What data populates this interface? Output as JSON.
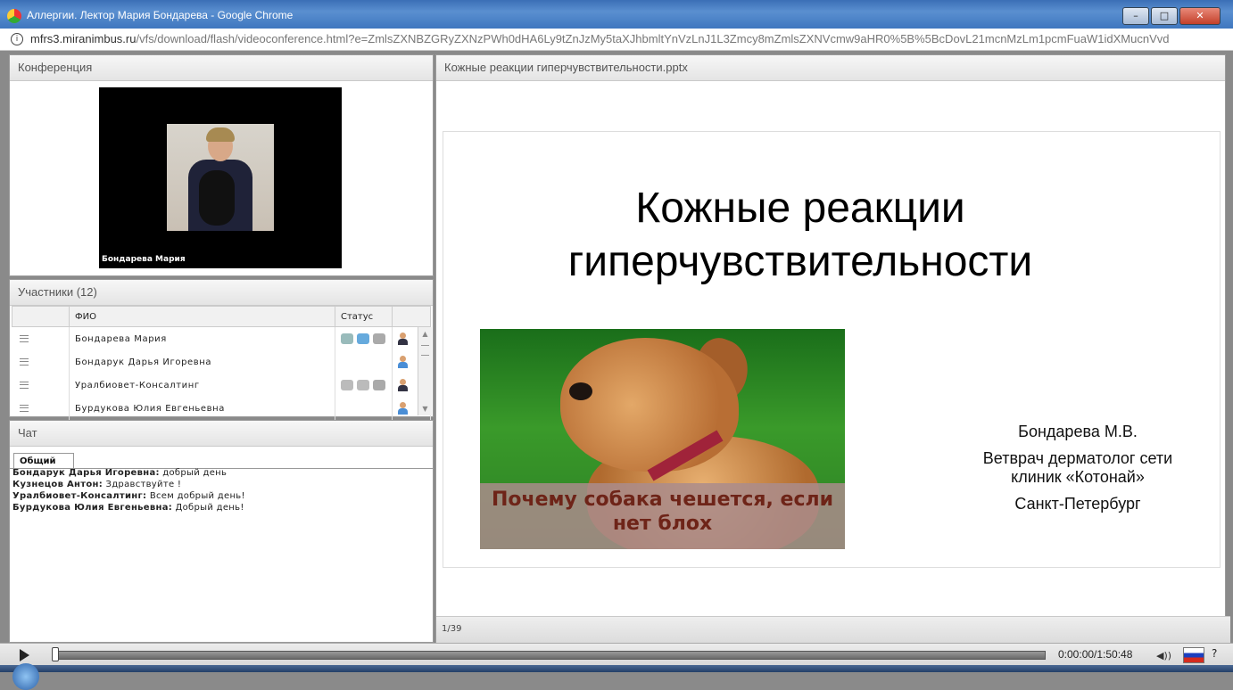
{
  "window": {
    "title": "Аллергии. Лектор Мария Бондарева - Google Chrome",
    "minimize": "–",
    "maximize": "□",
    "close": "✕"
  },
  "address": {
    "host": "mfrs3.miranimbus.ru",
    "path": "/vfs/download/flash/videoconference.html?e=ZmlsZXNBZGRyZXNzPWh0dHA6Ly9tZnJzMy5taXJhbmltYnVzLnJ1L3Zmcy8mZmlsZXNVcmw9aHR0%5B%5BcDovL21mcnMzLm1pcmFuaW1idXMucnVvd"
  },
  "conference": {
    "header": "Конференция",
    "video_name": "Бондарева Мария"
  },
  "participants": {
    "header": "Участники (12)",
    "col_name": "ФИО",
    "col_status": "Статус",
    "rows": [
      {
        "name": "Бондарева Мария"
      },
      {
        "name": "Бондарук Дарья  Игоревна"
      },
      {
        "name": "Уралбиовет-Консалтинг"
      },
      {
        "name": "Бурдукова Юлия  Евгеньевна"
      }
    ]
  },
  "chat": {
    "header": "Чат",
    "tab": "Общий",
    "messages": [
      {
        "author": "Бондарук Дарья  Игоревна:",
        "text": " добрый день"
      },
      {
        "author": "Кузнецов Антон:",
        "text": " Здравствуйте !"
      },
      {
        "author": "Уралбиовет-Консалтинг:",
        "text": " Всем добрый день!"
      },
      {
        "author": "Бурдукова Юлия  Евгеньевна:",
        "text": " Добрый день!"
      }
    ]
  },
  "presentation": {
    "header": "Кожные реакции гиперчувствительности.pptx",
    "slide_title_1": "Кожные реакции",
    "slide_title_2": "гиперчувствительности",
    "image_caption_1": "Почему собака чешется, если",
    "image_caption_2": "нет блох",
    "author_name": "Бондарева М.В.",
    "author_role": "Ветврач дерматолог сети клиник «Котонай»",
    "author_city": "Санкт-Петербург",
    "page_indicator": "1/39"
  },
  "player": {
    "time": "0:00:00/1:50:48",
    "help": "?"
  },
  "colors": {
    "accent": "#3b6fb6",
    "panel_border": "#9a9a9a"
  }
}
